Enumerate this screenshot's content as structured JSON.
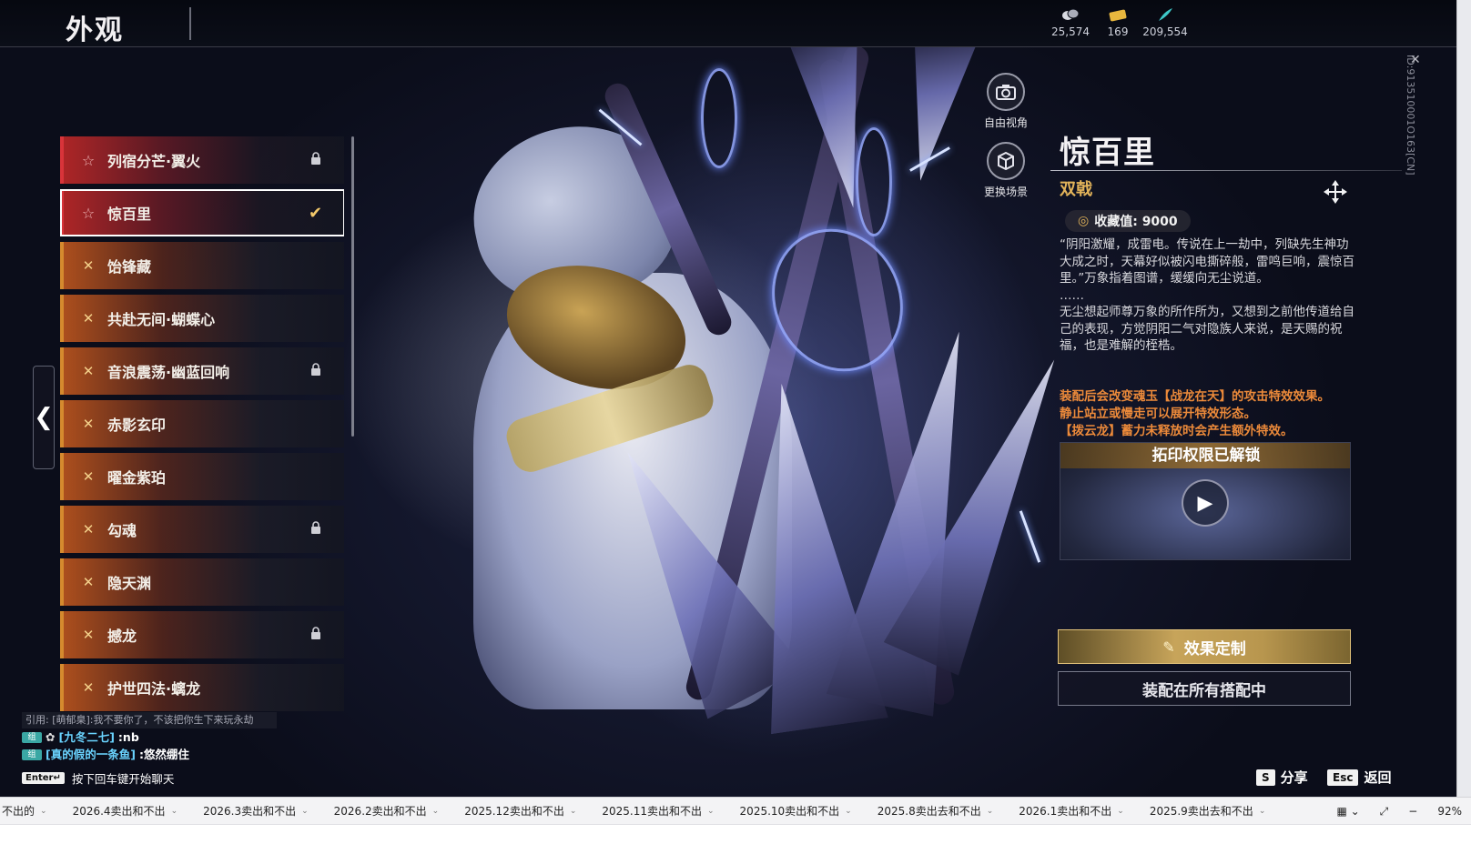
{
  "header": {
    "title": "外观",
    "currencies": [
      {
        "icon": "coin-stack-icon",
        "value": "25,574"
      },
      {
        "icon": "ticket-icon",
        "value": "169"
      },
      {
        "icon": "feather-icon",
        "value": "209,554"
      }
    ]
  },
  "list": {
    "items": [
      {
        "label": "列宿分芒·翼火",
        "variant": "red",
        "icon": "star-icon",
        "locked": true,
        "selected": false
      },
      {
        "label": "惊百里",
        "variant": "red",
        "icon": "star-icon",
        "locked": false,
        "selected": true
      },
      {
        "label": "饴锋藏",
        "variant": "orange",
        "icon": "cross-mark-icon",
        "locked": false,
        "selected": false
      },
      {
        "label": "共赴无间·蝴蝶心",
        "variant": "orange",
        "icon": "cross-mark-icon",
        "locked": false,
        "selected": false
      },
      {
        "label": "音浪震荡·幽蓝回响",
        "variant": "orange",
        "icon": "cross-mark-icon",
        "locked": true,
        "selected": false
      },
      {
        "label": "赤影玄印",
        "variant": "orange",
        "icon": "cross-mark-icon",
        "locked": false,
        "selected": false
      },
      {
        "label": "曜金紫珀",
        "variant": "orange",
        "icon": "cross-mark-icon",
        "locked": false,
        "selected": false
      },
      {
        "label": "勾魂",
        "variant": "orange",
        "icon": "cross-mark-icon",
        "locked": true,
        "selected": false
      },
      {
        "label": "隐天渊",
        "variant": "orange",
        "icon": "cross-mark-icon",
        "locked": false,
        "selected": false
      },
      {
        "label": "撼龙",
        "variant": "orange",
        "icon": "cross-mark-icon",
        "locked": true,
        "selected": false
      },
      {
        "label": "护世四法·螭龙",
        "variant": "orange",
        "icon": "cross-mark-icon",
        "locked": false,
        "selected": false
      }
    ]
  },
  "side_icons": {
    "free_view": "自由视角",
    "change_scene": "更换场景"
  },
  "detail": {
    "name": "惊百里",
    "type": "双戟",
    "collect_value": "收藏值: 9000",
    "description": [
      "“阴阳激耀，成雷电。传说在上一劫中，列缺先生神功大成之时，天幕好似被闪电撕碎般，雷鸣巨响，震惊百里。”万象指着图谱，缓缓向无尘说道。",
      "……",
      "无尘想起师尊万象的所作所为，又想到之前他传道给自己的表现，方觉阴阳二气对隐族人来说，是天赐的祝福，也是难解的桎梏。"
    ],
    "effect": [
      "装配后会改变魂玉【战龙在天】的攻击特效效果。",
      "静止站立或慢走可以展开特效形态。",
      "【拨云龙】蓄力未释放时会产生额外特效。"
    ],
    "preview_banner": "拓印权限已解锁",
    "customize_button": "效果定制",
    "equip_button": "装配在所有搭配中"
  },
  "side_id": "ID:913510001O163[CN]",
  "chat": {
    "quote": "引用: [萌郁臬]:我不要你了，不该把你生下来玩永劫",
    "lines": [
      {
        "tag": "组",
        "name": "[九冬二七]",
        "message": ":nb"
      },
      {
        "tag": "组",
        "name": "[真的假的一条鱼]",
        "message": ":悠然绷住"
      }
    ],
    "enter_key": "Enter↵",
    "enter_hint": "按下回车键开始聊天"
  },
  "footer": {
    "share_key": "S",
    "share_label": "分享",
    "back_key": "Esc",
    "back_label": "返回"
  },
  "taskbar": {
    "tabs": [
      "不出的",
      "2026.4卖出和不出",
      "2026.3卖出和不出",
      "2026.2卖出和不出",
      "2025.12卖出和不出",
      "2025.11卖出和不出",
      "2025.10卖出和不出",
      "2025.8卖出去和不出",
      "2026.1卖出和不出",
      "2025.9卖出去和不出"
    ],
    "zoom": "92%"
  },
  "colors": {
    "accent_gold": "#e3b45a",
    "effect_orange": "#ec8a3a",
    "list_red": "#d8343a",
    "list_orange": "#d58a2e"
  }
}
